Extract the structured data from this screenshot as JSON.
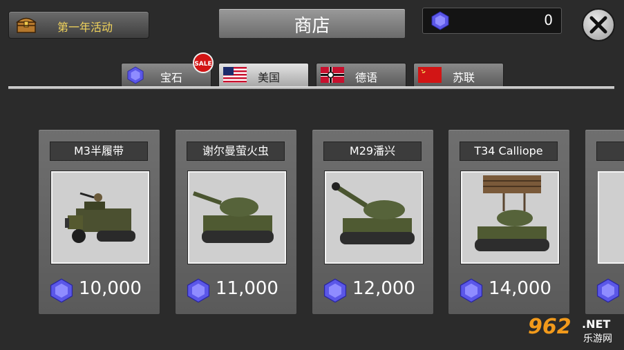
{
  "header": {
    "event_button": "第一年活动",
    "title": "商店",
    "gem_balance": "0",
    "close_icon": "close-icon"
  },
  "tabs": [
    {
      "label": "宝石",
      "icon": "gem-icon",
      "badge": "SALE",
      "active": false
    },
    {
      "label": "美国",
      "icon": "us-flag-icon",
      "active": true
    },
    {
      "label": "德语",
      "icon": "german-flag-icon",
      "active": false
    },
    {
      "label": "苏联",
      "icon": "soviet-flag-icon",
      "active": false
    }
  ],
  "items": [
    {
      "name": "M3半履带",
      "price": "10,000",
      "image": "halftrack-image"
    },
    {
      "name": "谢尔曼萤火虫",
      "price": "11,000",
      "image": "tank-image"
    },
    {
      "name": "M29潘兴",
      "price": "12,000",
      "image": "tank-image"
    },
    {
      "name": "T34 Calliope",
      "price": "14,000",
      "image": "rocket-tank-image"
    }
  ],
  "watermark": {
    "logo": "962",
    "net": ".NET",
    "sub": "乐游网"
  },
  "colors": {
    "gem": "#5b57e8",
    "event_text": "#f2d45c",
    "sale": "#d21515"
  }
}
